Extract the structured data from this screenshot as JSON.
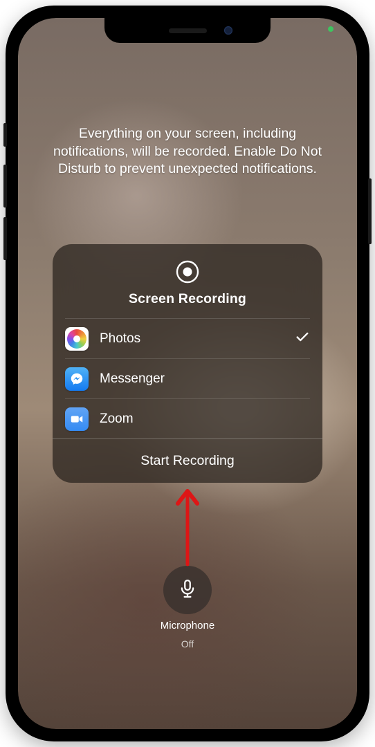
{
  "header": {
    "text": "Everything on your screen, including notifications, will be recorded. Enable Do Not Disturb to prevent unexpected notifications."
  },
  "panel": {
    "title": "Screen Recording",
    "start_label": "Start Recording",
    "apps": [
      {
        "label": "Photos",
        "selected": true
      },
      {
        "label": "Messenger",
        "selected": false
      },
      {
        "label": "Zoom",
        "selected": false
      }
    ]
  },
  "mic": {
    "label": "Microphone",
    "state": "Off"
  },
  "status": {
    "privacy_indicator": "camera-active"
  }
}
